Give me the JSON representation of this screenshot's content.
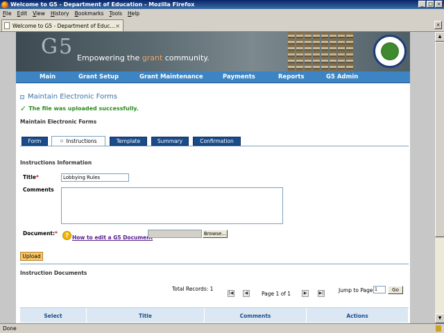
{
  "window": {
    "title": "Welcome to G5 - Department of Education - Mozilla Firefox"
  },
  "menubar": {
    "items": [
      {
        "key": "F",
        "rest": "ile"
      },
      {
        "key": "E",
        "rest": "dit"
      },
      {
        "key": "V",
        "rest": "iew"
      },
      {
        "key": "H",
        "rest": "istory"
      },
      {
        "key": "B",
        "rest": "ookmarks"
      },
      {
        "key": "T",
        "rest": "ools"
      },
      {
        "key": "H",
        "rest": "elp"
      }
    ]
  },
  "browser_tab": {
    "label": "Welcome to G5 - Department of Educ..."
  },
  "banner": {
    "logo": "G5",
    "tagline_pre": "Empowering the ",
    "tagline_accent": "grant",
    "tagline_post": " community."
  },
  "nav": {
    "items": [
      "Main",
      "Grant Setup",
      "Grant Maintenance",
      "Payments",
      "Reports",
      "G5 Admin"
    ]
  },
  "content": {
    "heading": "Maintain Electronic Forms",
    "success_message": "The file was uploaded successfully.",
    "section_title": "Maintain Electronic Forms",
    "tabs": [
      "Form",
      "Instructions",
      "Template",
      "Summary",
      "Confirmation"
    ],
    "instructions_heading": "Instructions Information",
    "title_label": "Title",
    "title_value": "Lobbying Rules",
    "comments_label": "Comments",
    "document_label": "Document:",
    "required_mark": "*",
    "help_link": "How to edit a G5 Document",
    "browse_button": "Browse...",
    "upload_button": "Upload",
    "instruction_docs_heading": "Instruction Documents",
    "total_records": "Total Records: 1",
    "page_info": "Page 1 of 1",
    "jump_label": "Jump to Page",
    "jump_value": "1",
    "go_button": "Go",
    "grid_columns": [
      "Select",
      "Title",
      "Comments",
      "Actions"
    ]
  },
  "status": {
    "text": "Done"
  }
}
